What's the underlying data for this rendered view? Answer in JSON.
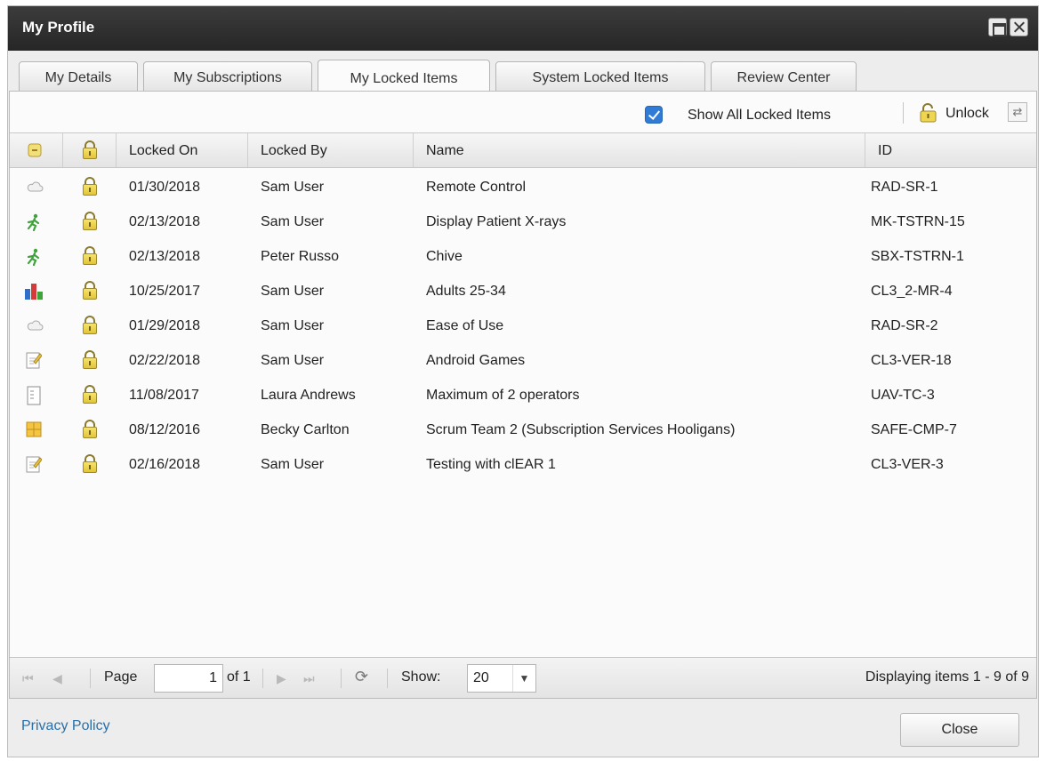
{
  "window": {
    "title": "My Profile"
  },
  "tabs": [
    {
      "label": "My Details"
    },
    {
      "label": "My Subscriptions"
    },
    {
      "label": "My Locked Items"
    },
    {
      "label": "System Locked Items"
    },
    {
      "label": "Review Center"
    }
  ],
  "toolbar": {
    "show_all_label": "Show All Locked Items",
    "show_all_checked": true,
    "unlock_label": "Unlock"
  },
  "grid": {
    "columns": [
      "Locked On",
      "Locked By",
      "Name",
      "ID"
    ],
    "rows": [
      {
        "icon": "cloud-icon",
        "locked_on": "01/30/2018",
        "locked_by": "Sam User",
        "name": "Remote Control",
        "id": "RAD-SR-1"
      },
      {
        "icon": "runner-icon",
        "locked_on": "02/13/2018",
        "locked_by": "Sam User",
        "name": "Display Patient X-rays",
        "id": "MK-TSTRN-15"
      },
      {
        "icon": "runner-icon",
        "locked_on": "02/13/2018",
        "locked_by": "Peter Russo",
        "name": "Chive",
        "id": "SBX-TSTRN-1"
      },
      {
        "icon": "bar-chart-icon",
        "locked_on": "10/25/2017",
        "locked_by": "Sam User",
        "name": "Adults 25-34",
        "id": "CL3_2-MR-4"
      },
      {
        "icon": "cloud-icon",
        "locked_on": "01/29/2018",
        "locked_by": "Sam User",
        "name": "Ease of Use",
        "id": "RAD-SR-2"
      },
      {
        "icon": "edit-document-icon",
        "locked_on": "02/22/2018",
        "locked_by": "Sam User",
        "name": "Android Games",
        "id": "CL3-VER-18"
      },
      {
        "icon": "document-icon",
        "locked_on": "11/08/2017",
        "locked_by": "Laura Andrews",
        "name": "Maximum of 2 operators",
        "id": "UAV-TC-3"
      },
      {
        "icon": "grid-icon",
        "locked_on": "08/12/2016",
        "locked_by": "Becky Carlton",
        "name": "Scrum Team 2 (Subscription Services Hooligans)",
        "id": "SAFE-CMP-7"
      },
      {
        "icon": "edit-document-icon",
        "locked_on": "02/16/2018",
        "locked_by": "Sam User",
        "name": "Testing with clEAR 1",
        "id": "CL3-VER-3"
      }
    ]
  },
  "pager": {
    "page_label": "Page",
    "page_value": "1",
    "of_label": "of 1",
    "show_label": "Show:",
    "show_value": "20",
    "display_text": "Displaying items 1 - 9 of 9"
  },
  "footer": {
    "privacy_link": "Privacy Policy",
    "close_label": "Close"
  }
}
